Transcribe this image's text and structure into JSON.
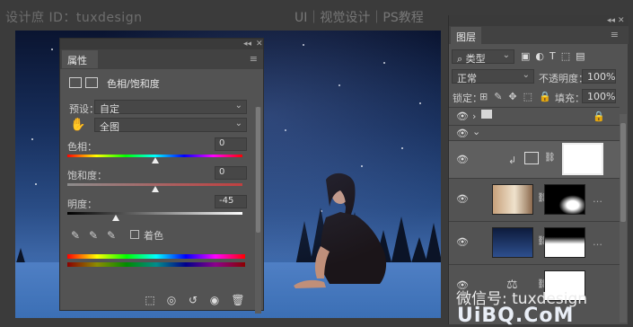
{
  "watermark": {
    "top_left": "设计庶 ID：tuxdesign",
    "top_right": "UI｜视觉设计｜PS教程",
    "wechat": "微信号: tuxdesign",
    "site": "UiBQ.CoM"
  },
  "properties": {
    "tab": "属性",
    "adjustment_name": "色相/饱和度",
    "preset_label": "预设：",
    "preset_value": "自定",
    "range_value": "全图",
    "hue_label": "色相：",
    "hue_value": "0",
    "hue_level": 0.5,
    "saturation_label": "饱和度：",
    "saturation_value": "0",
    "saturation_level": 0.5,
    "lightness_label": "明度：",
    "lightness_value": "-45",
    "lightness_level": 0.275,
    "colorize_label": "着色",
    "colorize_checked": false
  },
  "layers": {
    "tab": "图层",
    "filter_kind": "类型",
    "blend_mode": "正常",
    "opacity_label": "不透明度：",
    "opacity_value": "100%",
    "lock_label": "锁定：",
    "fill_label": "填充：",
    "fill_value": "100%"
  },
  "icons": [
    "eye-icon",
    "folder-icon",
    "lock-icon",
    "chain-icon",
    "hand-icon",
    "eyedropper-icon",
    "trash-icon",
    "reset-icon",
    "visibility-icon",
    "clip-icon"
  ],
  "colors": {
    "panel": "#535353",
    "panel_dark": "#424242",
    "canvas_sky": "#18305e",
    "selected_layer": "#5f5f5f"
  }
}
